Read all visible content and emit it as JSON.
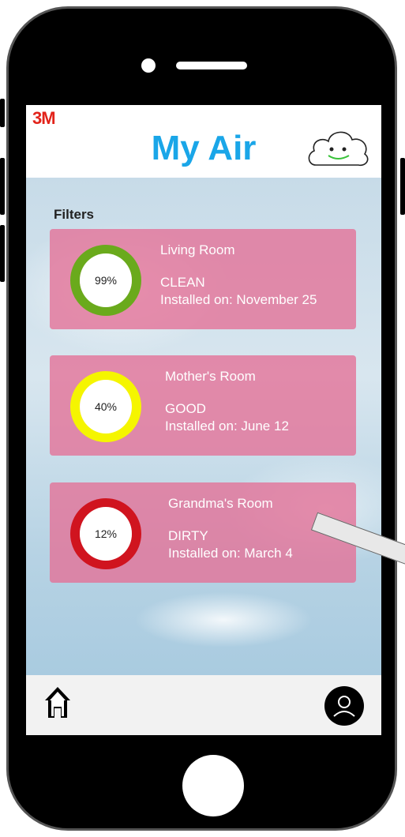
{
  "header": {
    "brand": "3M",
    "title": "My Air",
    "icon": "smiling-cloud-icon"
  },
  "filters": {
    "heading": "Filters",
    "items": [
      {
        "room": "Living Room",
        "percent": "99%",
        "status": "CLEAN",
        "installed": "Installed on: November 25",
        "color": "#6aaa1c"
      },
      {
        "room": "Mother's Room",
        "percent": "40%",
        "status": "GOOD",
        "installed": "Installed on: June 12",
        "color": "#f5f500"
      },
      {
        "room": "Grandma's Room",
        "percent": "12%",
        "status": "DIRTY",
        "installed": "Installed on: March 4",
        "color": "#d0141f"
      }
    ]
  },
  "nav": {
    "home_icon": "home-icon",
    "profile_icon": "profile-icon"
  },
  "colors": {
    "title": "#1aa6e8",
    "brand": "#e2231a",
    "card": "#e46f96"
  }
}
